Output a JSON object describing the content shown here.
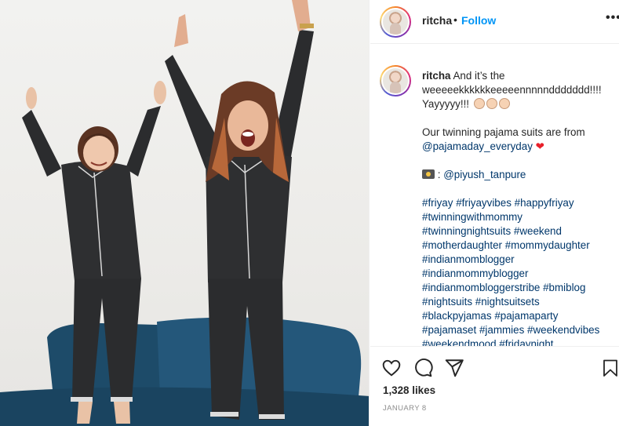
{
  "post": {
    "username": "ritcha",
    "dot": "•",
    "follow_label": "Follow",
    "more_label": "•••"
  },
  "caption": {
    "username": "ritcha",
    "line1": "And it’s the weeeeekkkkkkeeeeennnnnddddddd!!!! Yayyyyy!!!",
    "line2_prefix": "Our twinning pajama suits are from",
    "mention_brand": "@pajamaday_everyday",
    "photo_prefix": ":",
    "mention_photographer": "@piyush_tanpure",
    "hashtags": [
      "#friyay",
      "#friyayvibes",
      "#happyfriyay",
      "#twinningwithmommy",
      "#twinningnightsuits",
      "#weekend",
      "#motherdaughter",
      "#mommydaughter",
      "#indianmomblogger",
      "#indianmommyblogger",
      "#indianmombloggerstribe",
      "#bmiblog",
      "#nightsuits",
      "#nightsuitsets",
      "#blackpyjamas",
      "#pajamaparty",
      "#pajamaset",
      "#jammies",
      "#weekendvibes",
      "#weekendmood",
      "#fridaynight"
    ]
  },
  "stats": {
    "likes": "1,328 likes",
    "date": "JANUARY 8"
  },
  "icons": {
    "like": "heart-outline-icon",
    "comment": "comment-bubble-icon",
    "share": "paper-plane-icon",
    "save": "bookmark-icon",
    "camera": "camera-icon",
    "clap": "clapping-hands-icon",
    "heart": "red-heart-icon"
  },
  "colors": {
    "follow_blue": "#0095f6",
    "link_navy": "#00376b",
    "heart_red": "#e8202a",
    "pajama_black": "#2b2c2e",
    "pillow_blue": "#1f4f6e"
  }
}
